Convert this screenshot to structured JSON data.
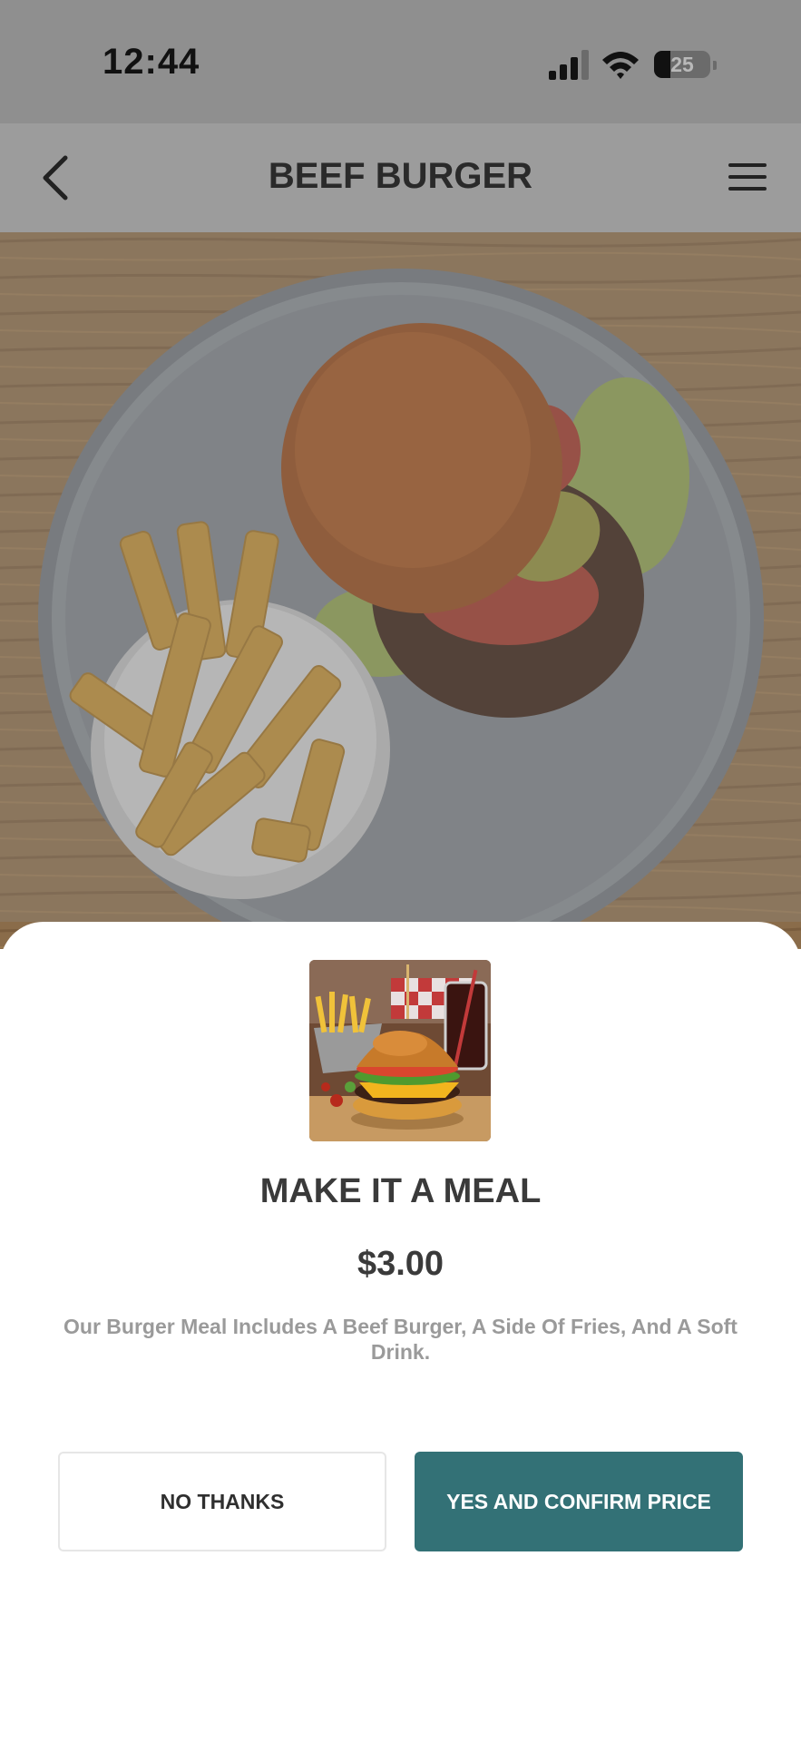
{
  "status_bar": {
    "time": "12:44",
    "battery": "25",
    "icons": [
      "signal-icon",
      "wifi-icon",
      "battery-icon"
    ]
  },
  "nav": {
    "title": "BEEF BURGER",
    "back_icon": "chevron-left-icon",
    "menu_icon": "hamburger-menu-icon"
  },
  "hero": {
    "image": "burger-and-fries-photo"
  },
  "upsell": {
    "image": "burger-meal-photo",
    "title": "MAKE IT A MEAL",
    "price": "$3.00",
    "description": "Our Burger Meal Includes A Beef Burger, A Side Of Fries, And A Soft Drink.",
    "decline_label": "NO THANKS",
    "confirm_label": "YES AND CONFIRM PRICE"
  },
  "colors": {
    "accent": "#337176",
    "overlay": "#8f8f8f",
    "text": "#3a3a3a",
    "muted_text": "#9a9a9a"
  }
}
